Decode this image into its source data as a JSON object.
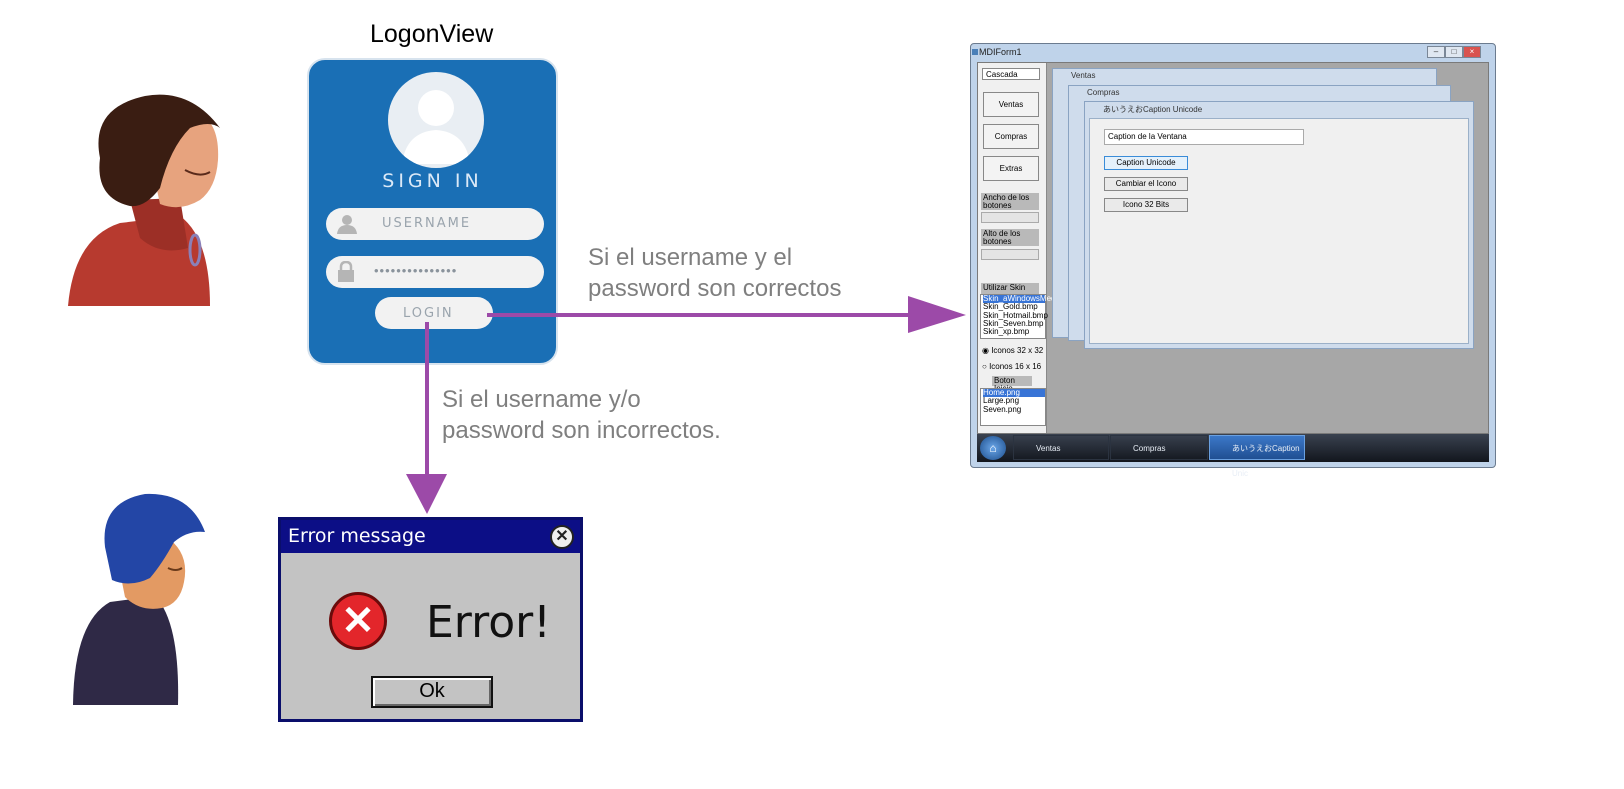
{
  "logon": {
    "title": "LogonView",
    "sign_in": "SIGN IN",
    "username_placeholder": "USERNAME",
    "password_mask": "•••••••••••••••",
    "login_label": "LOGIN"
  },
  "captions": {
    "success_line1": "Si el username y el",
    "success_line2": "password son correctos",
    "failure_line1": "Si el username y/o",
    "failure_line2": "password son incorrectos."
  },
  "error_dialog": {
    "title": "Error message",
    "close_glyph": "✕",
    "icon_glyph": "✕",
    "message": "Error!",
    "ok_label": "Ok"
  },
  "mdi": {
    "title": "MDIForm1",
    "combo_value": "Cascada",
    "buttons": [
      "Ventas",
      "Compras",
      "Extras"
    ],
    "ancho_label": "Ancho de los botones",
    "alto_label": "Alto de los botones",
    "skin_checkbox": "Utilizar Skin",
    "skins": [
      "Skin_aWindowsMed",
      "Skin_Gold.bmp",
      "Skin_Hotmail.bmp",
      "Skin_Seven.bmp",
      "Skin_xp.bmp"
    ],
    "radio_32": "Iconos 32 x 32",
    "radio_16": "Iconos 16 x 16",
    "boton_inicio": "Boton Inicio",
    "images": [
      "Home.png",
      "Large.png",
      "Seven.png"
    ],
    "child_ventas": "Ventas",
    "child_compras": "Compras",
    "child_unicode": "あいうえおCaption Unicode",
    "caption_field": "Caption de la Ventana",
    "btn_caption_unicode": "Caption Unicode",
    "btn_cambiar_icono": "Cambiar el Icono",
    "btn_icono_32": "Icono 32 Bits",
    "taskbar": [
      "Ventas",
      "Compras",
      "あいうえおCaption Unic"
    ]
  },
  "colors": {
    "arrow": "#9c4aa8",
    "logon_blue": "#1a6fb5",
    "dialog_navy": "#0c0e86",
    "caption_gray": "#7f7f7f"
  }
}
